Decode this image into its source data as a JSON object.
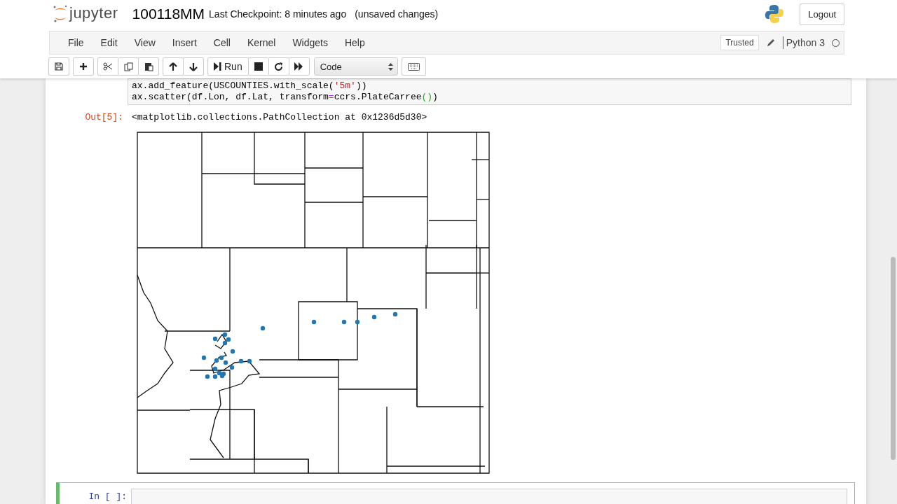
{
  "header": {
    "logo_text": "jupyter",
    "notebook_name": "100118MM",
    "checkpoint": "Last Checkpoint: 8 minutes ago",
    "save_status": "(unsaved changes)",
    "logout": "Logout"
  },
  "menu": [
    "File",
    "Edit",
    "View",
    "Insert",
    "Cell",
    "Kernel",
    "Widgets",
    "Help"
  ],
  "kernel": {
    "trusted": "Trusted",
    "name": "Python 3",
    "busy": false
  },
  "toolbar": {
    "run_label": "Run",
    "cell_type": "Code"
  },
  "cells": [
    {
      "kind": "code",
      "code_lines": [
        "ax.add_feature(USCOUNTIES.with_scale('5m'))",
        "ax.scatter(df.Lon, df.Lat, transform=ccrs.PlateCarree())"
      ],
      "selected": false
    },
    {
      "kind": "output",
      "prompt": "Out[5]:",
      "text": "<matplotlib.collections.PathCollection at 0x1236d5d30>"
    },
    {
      "kind": "code",
      "prompt": "In [ ]:",
      "selected": true
    }
  ]
}
